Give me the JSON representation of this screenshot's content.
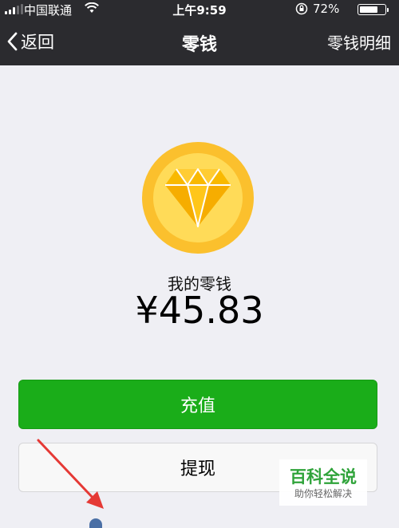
{
  "status_bar": {
    "carrier": "中国联通",
    "time": "上午9:59",
    "battery_percent": "72%",
    "battery_level": 0.72
  },
  "nav": {
    "back_label": "返回",
    "title": "零钱",
    "right_label": "零钱明细"
  },
  "wallet": {
    "label": "我的零钱",
    "balance": "¥45.83"
  },
  "actions": {
    "recharge_label": "充值",
    "withdraw_label": "提现"
  },
  "watermark": {
    "title": "百科全说",
    "subtitle": "助你轻松解决"
  },
  "colors": {
    "header_bg": "#2b2b2f",
    "page_bg": "#efeff4",
    "accent_green": "#1aad19",
    "coin_outer": "#fbc02d",
    "coin_inner": "#ffdb58",
    "annotation_arrow": "#e53935"
  }
}
